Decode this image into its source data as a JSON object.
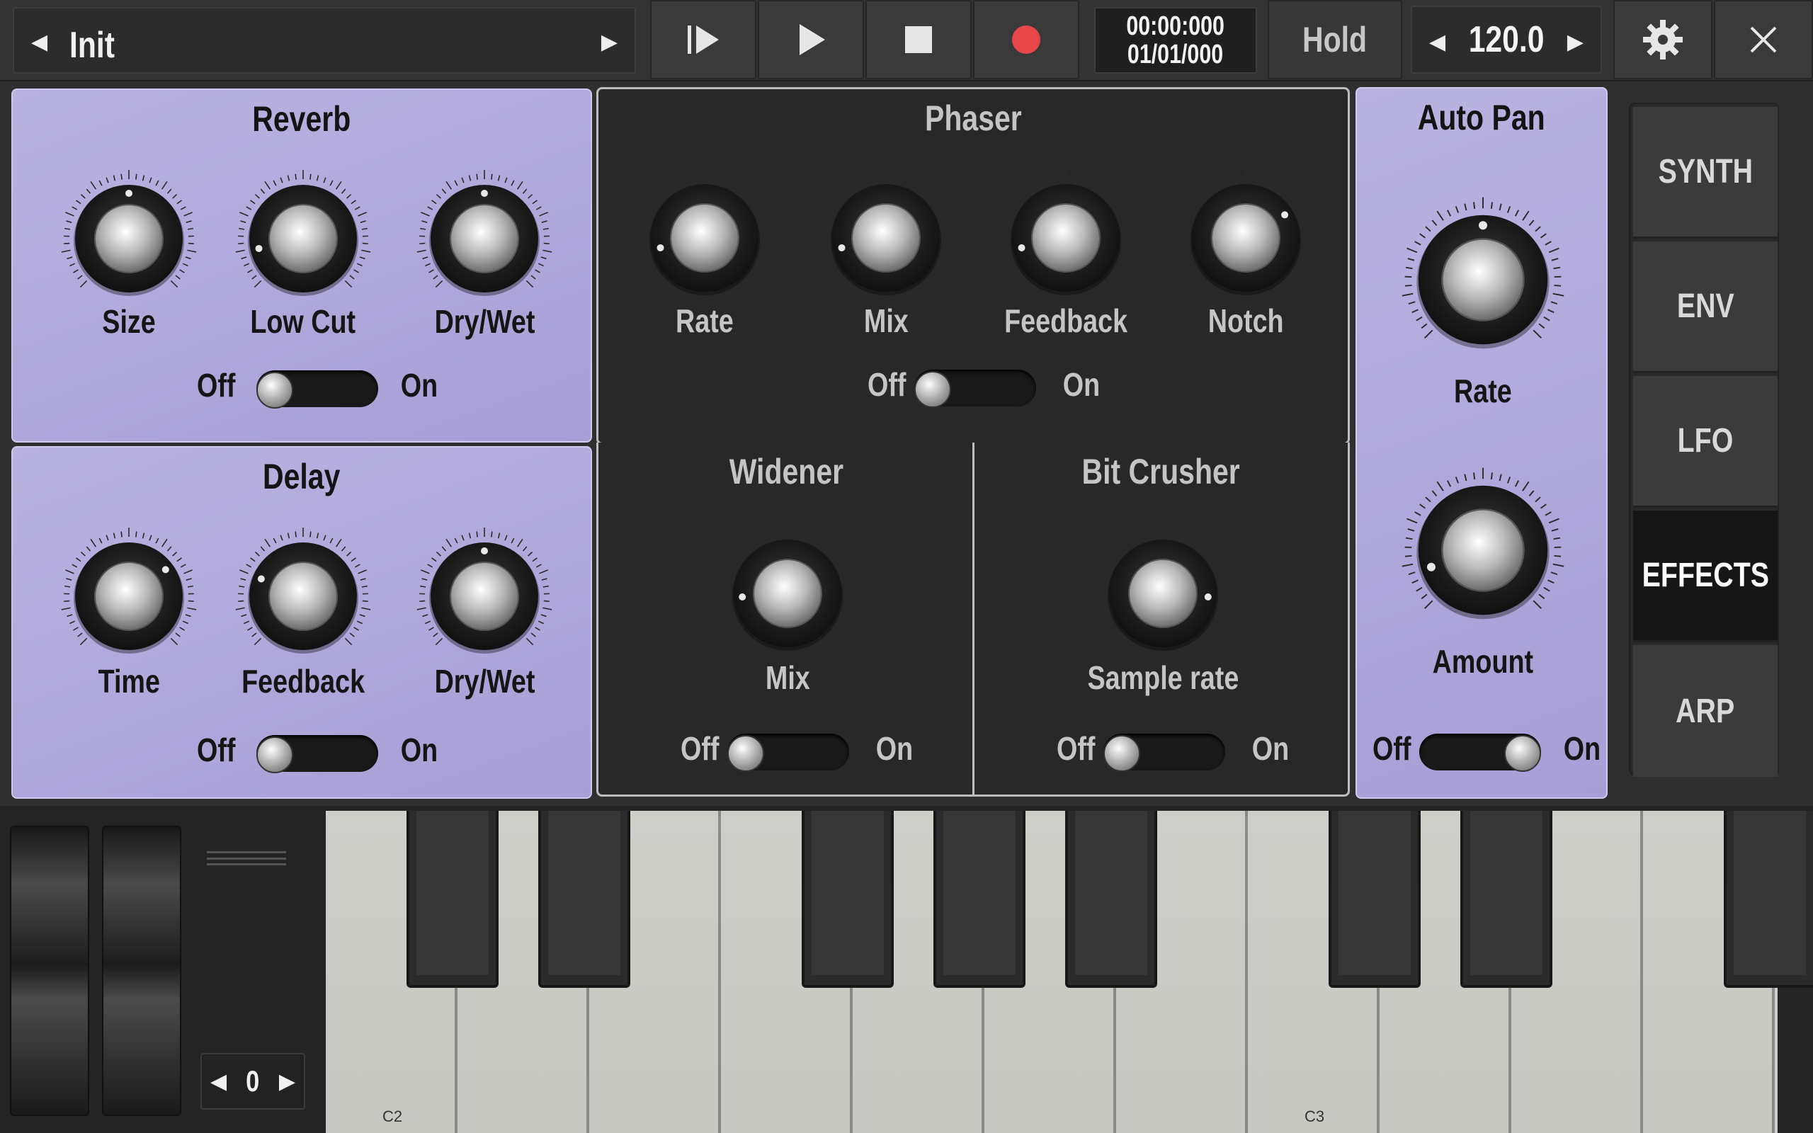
{
  "topbar": {
    "preset_name": "Init",
    "preset_prev_icon": "left-arrow-icon",
    "preset_next_icon": "right-arrow-icon",
    "time_position": "00:00:000",
    "time_date": "01/01/000",
    "hold_label": "Hold",
    "tempo": "120.0",
    "icons": [
      "play-from-start-icon",
      "play-icon",
      "stop-icon",
      "record-icon",
      "gear-icon",
      "close-icon"
    ],
    "record_color": "#e8474a"
  },
  "reverb": {
    "title": "Reverb",
    "knobs": [
      {
        "label": "Size",
        "value": 0.5
      },
      {
        "label": "Low Cut",
        "value": 0.12
      },
      {
        "label": "Dry/Wet",
        "value": 0.5
      }
    ],
    "toggle": {
      "off": "Off",
      "on": "On",
      "state": false
    }
  },
  "delay": {
    "title": "Delay",
    "knobs": [
      {
        "label": "Time",
        "value": 0.7
      },
      {
        "label": "Feedback",
        "value": 0.25
      },
      {
        "label": "Dry/Wet",
        "value": 0.5
      }
    ],
    "toggle": {
      "off": "Off",
      "on": "On",
      "state": false
    }
  },
  "phaser": {
    "title": "Phaser",
    "knobs": [
      {
        "label": "Rate",
        "value": 0.12
      },
      {
        "label": "Mix",
        "value": 0.12
      },
      {
        "label": "Feedback",
        "value": 0.12
      },
      {
        "label": "Notch",
        "value": 0.72
      }
    ],
    "toggle": {
      "off": "Off",
      "on": "On",
      "state": false
    }
  },
  "widener": {
    "title": "Widener",
    "knobs": [
      {
        "label": "Mix",
        "value": 0.15
      }
    ],
    "toggle": {
      "off": "Off",
      "on": "On",
      "state": false
    }
  },
  "bitcrusher": {
    "title": "Bit Crusher",
    "knobs": [
      {
        "label": "Sample rate",
        "value": 0.85
      }
    ],
    "toggle": {
      "off": "Off",
      "on": "On",
      "state": false
    }
  },
  "autopan": {
    "title": "Auto Pan",
    "knobs": [
      {
        "label": "Rate",
        "value": 0.5
      },
      {
        "label": "Amount",
        "value": 0.1
      }
    ],
    "toggle": {
      "off": "Off",
      "on": "On",
      "state": true
    }
  },
  "tabs": [
    {
      "label": "SYNTH",
      "active": false
    },
    {
      "label": "ENV",
      "active": false
    },
    {
      "label": "LFO",
      "active": false
    },
    {
      "label": "EFFECTS",
      "active": true
    },
    {
      "label": "ARP",
      "active": false
    }
  ],
  "keyboard": {
    "octave": "0",
    "labels": [
      "C2",
      "C3"
    ]
  },
  "colors": {
    "panel_lavender": "#b0a8dc",
    "panel_dark": "#282828"
  }
}
